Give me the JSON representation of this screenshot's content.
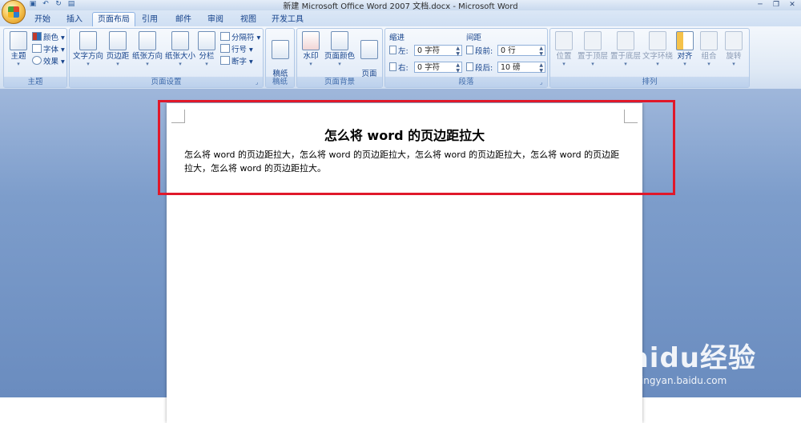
{
  "window": {
    "title": "新建 Microsoft Office Word 2007 文档.docx - Microsoft Word"
  },
  "tabs": [
    {
      "label": "开始"
    },
    {
      "label": "插入"
    },
    {
      "label": "页面布局"
    },
    {
      "label": "引用"
    },
    {
      "label": "邮件"
    },
    {
      "label": "审阅"
    },
    {
      "label": "视图"
    },
    {
      "label": "开发工具"
    }
  ],
  "active_tab": "页面布局",
  "ribbon": {
    "theme": {
      "label": "主题",
      "big": "主题",
      "colors": "颜色",
      "fonts": "字体",
      "effects": "效果"
    },
    "page_setup": {
      "label": "页面设置",
      "text_direction": "文字方向",
      "margins": "页边距",
      "orientation": "纸张方向",
      "size": "纸张大小",
      "columns": "分栏",
      "breaks": "分隔符",
      "line_numbers": "行号",
      "hyphenation": "断字"
    },
    "draft": {
      "label": "稿纸",
      "button": "稿纸\n设置"
    },
    "page_background": {
      "label": "页面背景",
      "watermark": "水印",
      "page_color": "页面颜色",
      "page_border": "页面\n边框"
    },
    "paragraph": {
      "label": "段落",
      "indent_header": "缩进",
      "spacing_header": "间距",
      "indent_left_label": "左:",
      "indent_left_value": "0 字符",
      "indent_right_label": "右:",
      "indent_right_value": "0 字符",
      "spacing_before_label": "段前:",
      "spacing_before_value": "0 行",
      "spacing_after_label": "段后:",
      "spacing_after_value": "10 磅"
    },
    "arrange": {
      "label": "排列",
      "position": "位置",
      "bring_front": "置于顶层",
      "send_back": "置于底层",
      "text_wrap": "文字环绕",
      "align": "对齐",
      "group": "组合",
      "rotate": "旋转"
    }
  },
  "document": {
    "title": "怎么将 word 的页边距拉大",
    "body": "怎么将 word 的页边距拉大，怎么将 word 的页边距拉大，怎么将 word 的页边距拉大，怎么将 word 的页边距拉大，怎么将 word 的页边距拉大。"
  },
  "watermark": {
    "brand": "Baidu经验",
    "url": "jingyan.baidu.com"
  },
  "colors": {
    "highlight": "#e0182a",
    "ribbon_text": "#15428b",
    "doc_background": "#7d9dcb"
  }
}
